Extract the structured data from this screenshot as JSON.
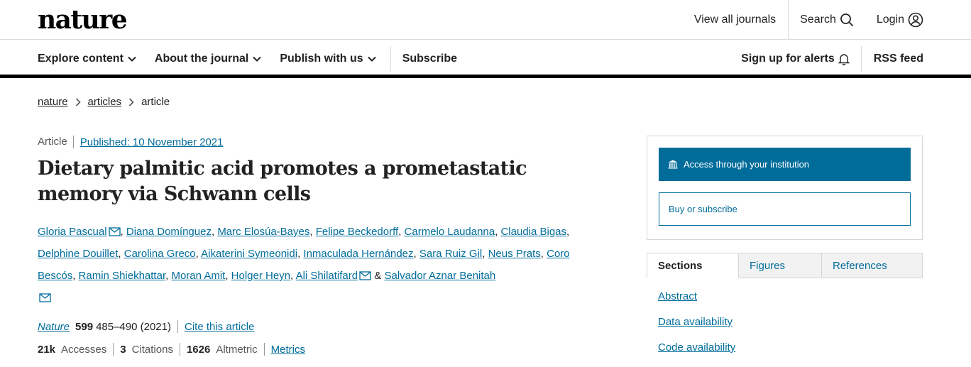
{
  "header": {
    "logo": "nature",
    "view_all_journals": "View all journals",
    "search": "Search",
    "login": "Login"
  },
  "nav": {
    "explore": "Explore content",
    "about": "About the journal",
    "publish": "Publish with us",
    "subscribe": "Subscribe",
    "alerts": "Sign up for alerts",
    "rss": "RSS feed"
  },
  "breadcrumb": [
    "nature",
    "articles",
    "article"
  ],
  "article": {
    "type": "Article",
    "published": "Published: 10 November 2021",
    "title": "Dietary palmitic acid promotes a prometastatic memory via Schwann cells",
    "authors": [
      "Gloria Pascual",
      "Diana Domínguez",
      "Marc Elosúa-Bayes",
      "Felipe Beckedorff",
      "Carmelo Laudanna",
      "Claudia Bigas",
      "Delphine Douillet",
      "Carolina Greco",
      "Aikaterini Symeonidi",
      "Inmaculada Hernández",
      "Sara Ruiz Gil",
      "Neus Prats",
      "Coro Bescós",
      "Ramin Shiekhattar",
      "Moran Amit",
      "Holger Heyn",
      "Ali Shilatifard",
      "Salvador Aznar Benitah"
    ],
    "author_joiner": "&",
    "journal": "Nature",
    "volume": "599",
    "pages_year": "485–490 (2021)",
    "cite": "Cite this article",
    "accesses_value": "21k",
    "accesses_label": "Accesses",
    "citations_value": "3",
    "citations_label": "Citations",
    "altmetric_value": "1626",
    "altmetric_label": "Altmetric",
    "metrics": "Metrics"
  },
  "access": {
    "institution": "Access through your institution",
    "buy": "Buy or subscribe"
  },
  "tabs": [
    "Sections",
    "Figures",
    "References"
  ],
  "sections": [
    "Abstract",
    "Data availability",
    "Code availability"
  ],
  "colors": {
    "accent": "#006c9a",
    "text": "#222222"
  }
}
